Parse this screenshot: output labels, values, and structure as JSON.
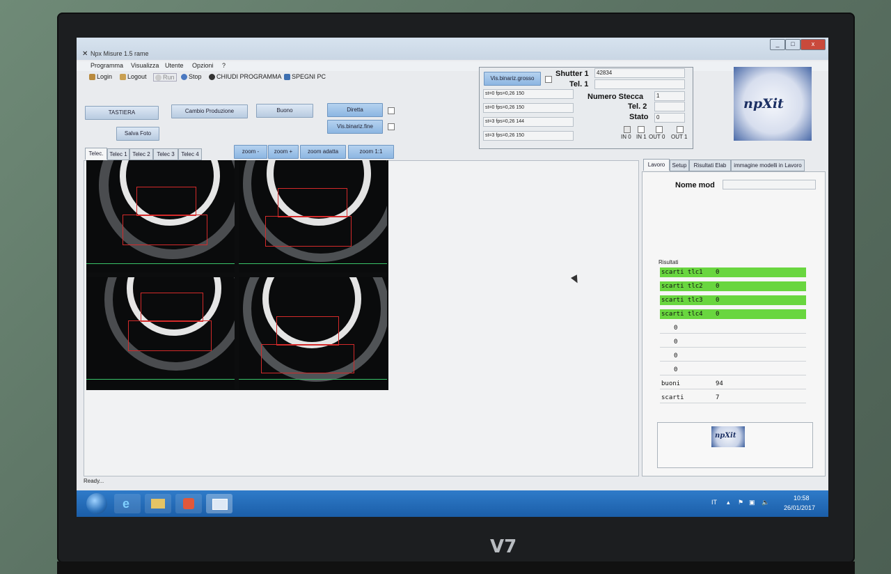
{
  "window": {
    "title": "Npx Misure 1.5 rame",
    "min": "_",
    "max": "□",
    "close": "x"
  },
  "menu": [
    "Programma",
    "Visualizza",
    "Utente",
    "Opzioni",
    "?"
  ],
  "toolbar": {
    "login": "Login",
    "logout": "Logout",
    "run": "Run",
    "stop": "Stop",
    "close_program": "CHIUDI PROGRAMMA",
    "shutdown": "SPEGNI PC"
  },
  "buttons": {
    "tastiera": "TASTIERA",
    "cambio": "Cambio Produzione",
    "buono": "Buono",
    "diretta": "Diretta",
    "salva_foto": "Salva Foto",
    "vis_fine": "Vis.binariz.fine",
    "vis_grosso": "Vis.binariz.grosso"
  },
  "cam_tabs": [
    "Telec.",
    "Telec 1",
    "Telec 2",
    "Telec 3",
    "Telec 4"
  ],
  "zoom": {
    "minus": "zoom -",
    "plus": "zoom +",
    "adatta": "zoom adatta",
    "one": "zoom 1:1"
  },
  "stats": [
    "st=0 fps=0,26 150",
    "st=0 fps=0,26 150",
    "st=3 fps=0,26 144",
    "st=3 fps=0,26 150"
  ],
  "info": {
    "shutter_label": "Shutter 1",
    "shutter_value": "42834",
    "tel1_label": "Tel. 1",
    "tel1_value": "",
    "stecca_label": "Numero Stecca",
    "stecca_value": "1",
    "tel2_label": "Tel. 2",
    "tel2_value": "",
    "stato_label": "Stato",
    "stato_value": "0",
    "io": [
      "IN 0",
      "IN 1",
      "OUT 0",
      "OUT 1"
    ]
  },
  "right_tabs": [
    "Lavoro",
    "Setup",
    "Risultati Elab",
    "immagine modelli in Lavoro"
  ],
  "nome_mod_label": "Nome mod",
  "risultati_label": "Risultati",
  "results_green": [
    {
      "name": "scarti tlc1",
      "value": "0"
    },
    {
      "name": "scarti tlc2",
      "value": "0"
    },
    {
      "name": "scarti tlc3",
      "value": "0"
    },
    {
      "name": "scarti tlc4",
      "value": "0"
    }
  ],
  "results_plain": [
    {
      "name": "",
      "value": "0"
    },
    {
      "name": "",
      "value": "0"
    },
    {
      "name": "",
      "value": "0"
    },
    {
      "name": "",
      "value": "0"
    },
    {
      "name": "buoni",
      "value": "94"
    },
    {
      "name": "scarti",
      "value": "7"
    }
  ],
  "logo_text": "npXit",
  "status": "Ready...",
  "tray": {
    "lang": "IT",
    "time": "10:58",
    "date": "26/01/2017"
  },
  "monitor_brand": "V7",
  "colors": {
    "green_row": "#69d63f",
    "button_blue": "#8cb6e2",
    "red_roi": "#d42a2a"
  }
}
